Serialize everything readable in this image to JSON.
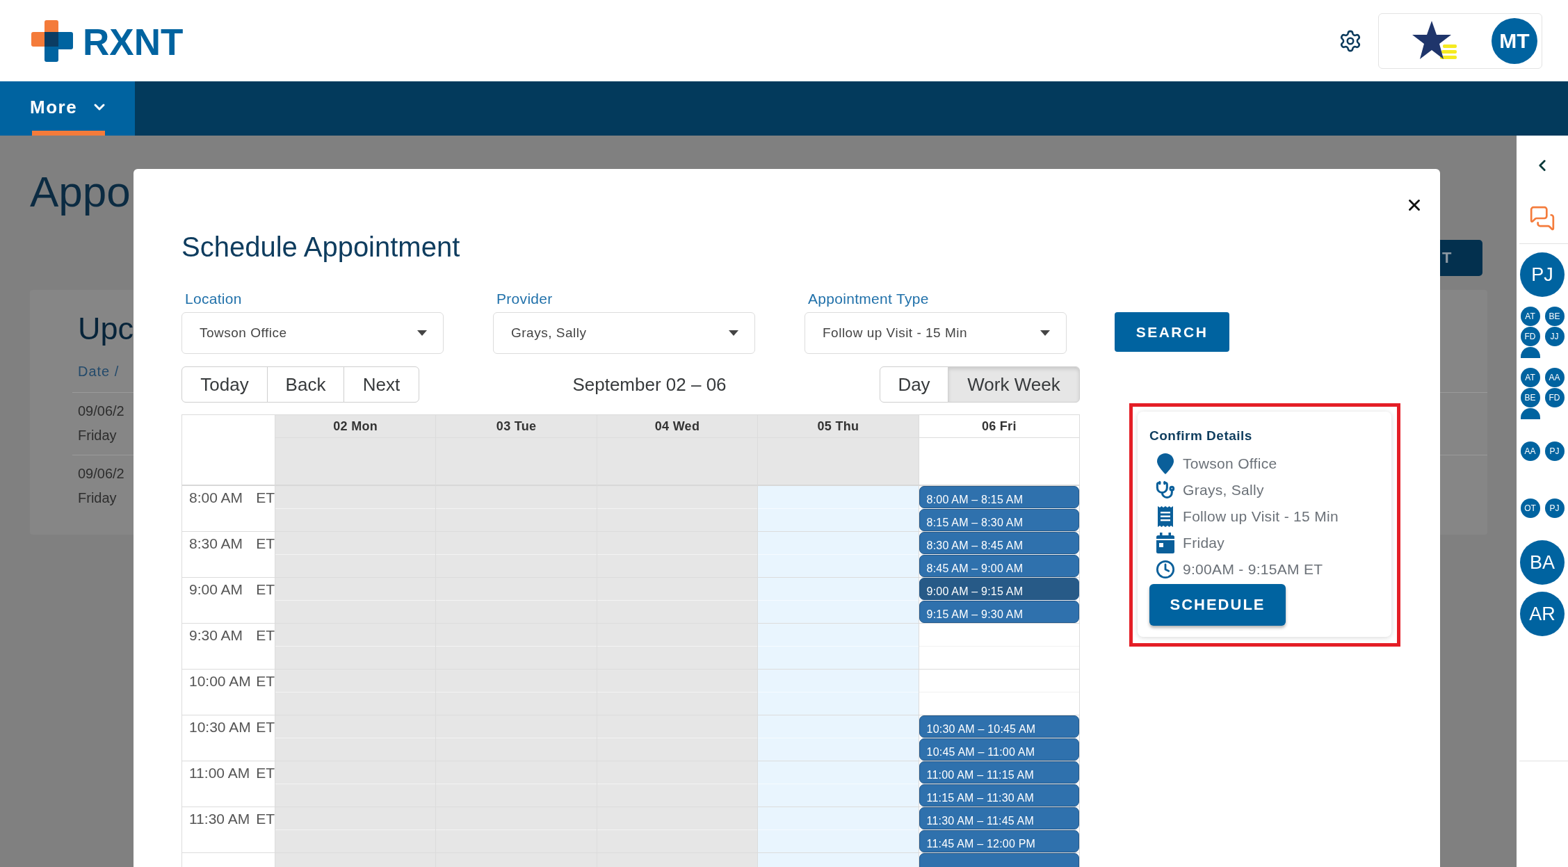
{
  "header": {
    "logo_text": "RXNT",
    "user_initials": "MT"
  },
  "nav": {
    "items": [
      {
        "label": "More",
        "selected": true
      }
    ]
  },
  "background_page": {
    "title": "Appo",
    "action_button": "T",
    "card": {
      "title": "Upc",
      "column": "Date /",
      "rows": [
        {
          "date": "09/06/2",
          "day": "Friday"
        },
        {
          "date": "09/06/2",
          "day": "Friday"
        }
      ]
    }
  },
  "right_sidebar": {
    "avatars": [
      {
        "kind": "large",
        "initials": "PJ"
      },
      {
        "kind": "group",
        "members": [
          "AT",
          "BE",
          "FD",
          "JJ"
        ],
        "clipped_extra": true
      },
      {
        "kind": "group",
        "members": [
          "AT",
          "AA",
          "BE",
          "FD"
        ],
        "clipped_extra": true
      },
      {
        "kind": "group",
        "members": [
          "AA",
          "PJ"
        ],
        "clipped_extra": false
      },
      {
        "kind": "group",
        "members": [
          "OT",
          "PJ"
        ],
        "clipped_extra": false
      },
      {
        "kind": "large",
        "initials": "BA"
      },
      {
        "kind": "large",
        "initials": "AR"
      }
    ]
  },
  "modal": {
    "title": "Schedule Appointment",
    "fields": [
      {
        "label": "Location",
        "value": "Towson Office"
      },
      {
        "label": "Provider",
        "value": "Grays, Sally"
      },
      {
        "label": "Appointment Type",
        "value": "Follow up Visit - 15 Min"
      }
    ],
    "search_button": "SEARCH",
    "toolbar": {
      "nav_buttons": [
        "Today",
        "Back",
        "Next"
      ],
      "range_label": "September 02 – 06",
      "views": [
        {
          "label": "Day",
          "selected": false
        },
        {
          "label": "Work Week",
          "selected": true
        }
      ]
    },
    "calendar": {
      "days": [
        {
          "label": "02 Mon",
          "kind": "closed"
        },
        {
          "label": "03 Tue",
          "kind": "closed"
        },
        {
          "label": "04 Wed",
          "kind": "closed"
        },
        {
          "label": "05 Thu",
          "kind": "today"
        },
        {
          "label": "06 Fri",
          "kind": "open"
        }
      ],
      "rows": [
        {
          "time": "8:00 AM",
          "zone": "ET",
          "slots": [
            {
              "label": "8:00 AM – 8:15 AM",
              "selected": false
            },
            {
              "label": "8:15 AM – 8:30 AM",
              "selected": false
            }
          ]
        },
        {
          "time": "8:30 AM",
          "zone": "ET",
          "slots": [
            {
              "label": "8:30 AM – 8:45 AM",
              "selected": false
            },
            {
              "label": "8:45 AM – 9:00 AM",
              "selected": false
            }
          ]
        },
        {
          "time": "9:00 AM",
          "zone": "ET",
          "slots": [
            {
              "label": "9:00 AM – 9:15 AM",
              "selected": true
            },
            {
              "label": "9:15 AM – 9:30 AM",
              "selected": false
            }
          ]
        },
        {
          "time": "9:30 AM",
          "zone": "ET"
        },
        {
          "time": "10:00 AM",
          "zone": "ET"
        },
        {
          "time": "10:30 AM",
          "zone": "ET",
          "slots": [
            {
              "label": "10:30 AM – 10:45 AM",
              "selected": false
            },
            {
              "label": "10:45 AM – 11:00 AM",
              "selected": false
            }
          ]
        },
        {
          "time": "11:00 AM",
          "zone": "ET",
          "slots": [
            {
              "label": "11:00 AM – 11:15 AM",
              "selected": false
            },
            {
              "label": "11:15 AM – 11:30 AM",
              "selected": false
            }
          ]
        },
        {
          "time": "11:30 AM",
          "zone": "ET",
          "slots": [
            {
              "label": "11:30 AM – 11:45 AM",
              "selected": false
            },
            {
              "label": "11:45 AM – 12:00 PM",
              "selected": false
            }
          ]
        },
        {
          "slots": [
            {
              "selected": false
            }
          ]
        }
      ]
    },
    "confirm": {
      "title": "Confirm Details",
      "highlighted": true,
      "items": [
        {
          "kind": "location",
          "text": "Towson Office"
        },
        {
          "kind": "provider",
          "text": "Grays, Sally"
        },
        {
          "kind": "type",
          "text": "Follow up Visit - 15 Min"
        },
        {
          "kind": "date",
          "text": "Friday"
        },
        {
          "kind": "time",
          "text": "9:00AM - 9:15AM ET"
        }
      ],
      "button": "SCHEDULE"
    }
  }
}
